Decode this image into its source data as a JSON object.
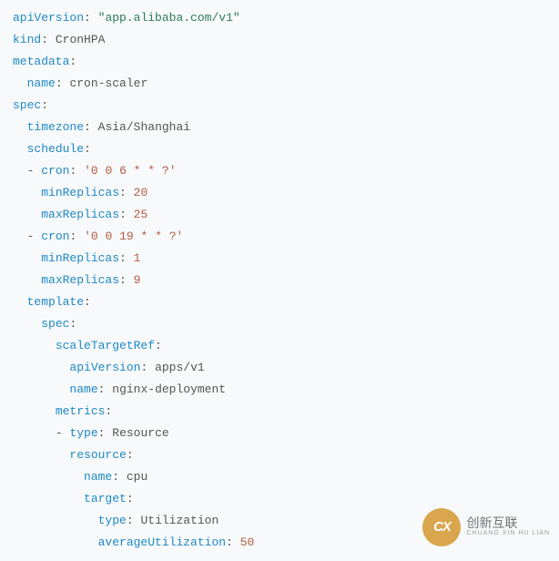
{
  "k": {
    "apiVersion": "apiVersion",
    "kind": "kind",
    "metadata": "metadata",
    "name": "name",
    "spec": "spec",
    "timezone": "timezone",
    "schedule": "schedule",
    "cron": "cron",
    "minReplicas": "minReplicas",
    "maxReplicas": "maxReplicas",
    "template": "template",
    "scaleTargetRef": "scaleTargetRef",
    "metrics": "metrics",
    "type": "type",
    "resource": "resource",
    "target": "target",
    "averageUtilization": "averageUtilization"
  },
  "v": {
    "apiVersion": "\"app.alibaba.com/v1\"",
    "kind": "CronHPA",
    "name": "cron-scaler",
    "timezone": "Asia/Shanghai",
    "cron1": "'0 0 6 * * ?'",
    "min1": "20",
    "max1": "25",
    "cron2": "'0 0 19 * * ?'",
    "min2": "1",
    "max2": "9",
    "starApiVersion": "apps/v1",
    "starName": "nginx-deployment",
    "metricType": "Resource",
    "resourceName": "cpu",
    "targetType": "Utilization",
    "avgUtil": "50"
  },
  "p": {
    "colon": ":",
    "dash": "-"
  },
  "wm": {
    "icon": "CX",
    "text": "创新互联",
    "sub": "CHUANG XIN HU LIAN"
  }
}
